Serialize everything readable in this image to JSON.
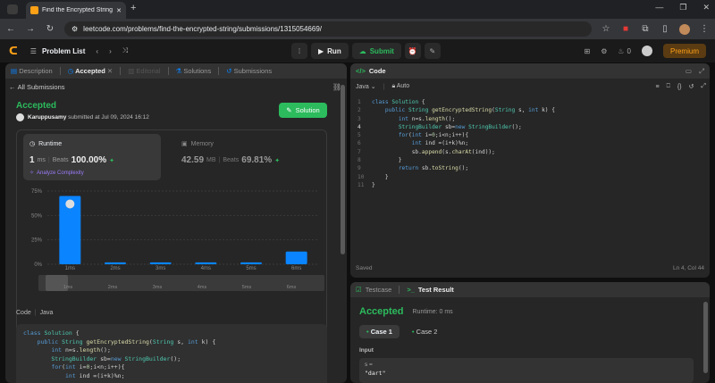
{
  "browser": {
    "tab_title": "Find the Encrypted String - Leet",
    "url": "leetcode.com/problems/find-the-encrypted-string/submissions/1315054669/"
  },
  "header": {
    "problem_list": "Problem List",
    "run": "Run",
    "submit": "Submit",
    "streak": "0",
    "premium": "Premium"
  },
  "left": {
    "tabs": [
      "Description",
      "Accepted",
      "Editorial",
      "Solutions",
      "Submissions"
    ],
    "back": "All Submissions",
    "status": "Accepted",
    "user": "Karuppusamy",
    "submitted": "submitted at Jul 09, 2024 16:12",
    "solution_btn": "Solution",
    "runtime": {
      "label": "Runtime",
      "value": "1",
      "unit": "ms",
      "beats_label": "Beats",
      "beats": "100.00%",
      "analyze": "Analyze Complexity"
    },
    "memory": {
      "label": "Memory",
      "value": "42.59",
      "unit": "MB",
      "beats_label": "Beats",
      "beats": "69.81%"
    },
    "code_label": "Code",
    "lang": "Java",
    "code_preview": [
      "class Solution {",
      "    public String getEncryptedString(String s, int k) {",
      "        int n=s.length();",
      "        StringBuilder sb=new StringBuilder();",
      "        for(int i=0;i<n;i++){",
      "            int ind =(i+k)%n;"
    ]
  },
  "chart_data": {
    "type": "bar",
    "categories": [
      "1ms",
      "2ms",
      "3ms",
      "4ms",
      "5ms",
      "6ms"
    ],
    "values": [
      70,
      2,
      2,
      2,
      2,
      13
    ],
    "yticks": [
      "75%",
      "50%",
      "25%",
      "0%"
    ],
    "ylim": [
      0,
      75
    ],
    "color": "#0a84ff"
  },
  "editor": {
    "title": "Code",
    "lang": "Java",
    "auto": "Auto",
    "saved": "Saved",
    "cursor": "Ln 4, Col 44",
    "lines": [
      "class Solution {",
      "    public String getEncryptedString(String s, int k) {",
      "        int n=s.length();",
      "        StringBuilder sb=new StringBuilder();",
      "        for(int i=0;i<n;i++){",
      "            int ind =(i+k)%n;",
      "            sb.append(s.charAt(ind));",
      "        }",
      "        return sb.toString();",
      "    }",
      "}"
    ]
  },
  "testpanel": {
    "tab1": "Testcase",
    "tab2": "Test Result",
    "status": "Accepted",
    "runtime": "Runtime: 0 ms",
    "case1": "Case 1",
    "case2": "Case 2",
    "input_label": "Input",
    "var": "s =",
    "val": "\"dart\""
  }
}
